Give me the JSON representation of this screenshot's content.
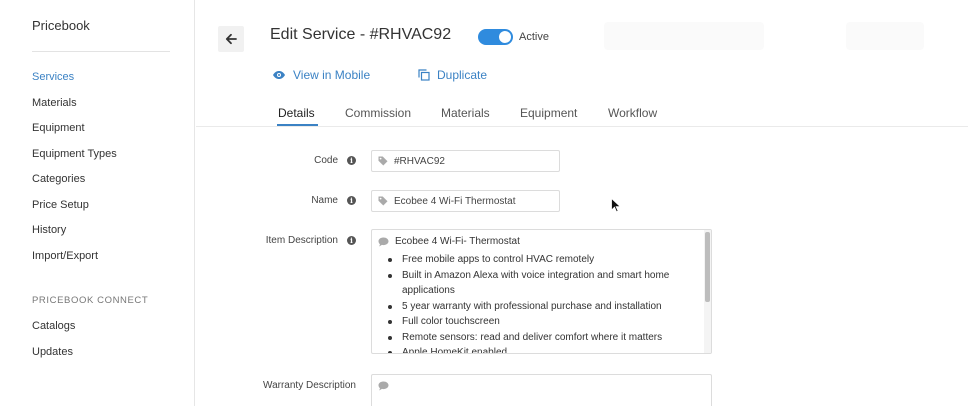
{
  "sidebar": {
    "title": "Pricebook",
    "items": [
      "Services",
      "Materials",
      "Equipment",
      "Equipment Types",
      "Categories",
      "Price Setup",
      "History",
      "Import/Export"
    ],
    "active_item": "Services",
    "section_heading": "PRICEBOOK CONNECT",
    "section_items": [
      "Catalogs",
      "Updates"
    ]
  },
  "header": {
    "title": "Edit Service - #RHVAC92",
    "status_label": "Active",
    "status_on": true,
    "view_mobile": "View in Mobile",
    "duplicate": "Duplicate"
  },
  "tabs": [
    "Details",
    "Commission",
    "Materials",
    "Equipment",
    "Workflow"
  ],
  "active_tab": "Details",
  "form": {
    "code_label": "Code",
    "code_value": "#RHVAC92",
    "name_label": "Name",
    "name_value": "Ecobee 4 Wi-Fi Thermostat",
    "item_desc_label": "Item Description",
    "item_desc_title": "Ecobee 4 Wi-Fi- Thermostat",
    "item_desc_bullets": [
      "Free mobile apps to control HVAC remotely",
      "Built in Amazon Alexa with voice integration and smart home applications",
      "5 year warranty with professional purchase and installation",
      "Full color touchscreen",
      "Remote sensors: read and deliver comfort where it matters",
      "Apple HomeKit enabled"
    ],
    "warranty_label": "Warranty Description"
  },
  "colors": {
    "accent": "#3b82c4",
    "toggle": "#2f8bde"
  }
}
